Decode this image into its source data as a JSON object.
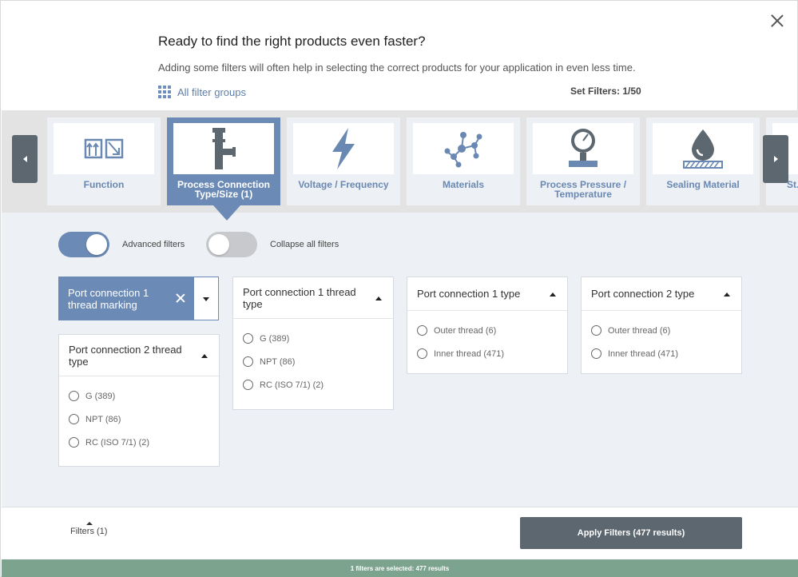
{
  "header": {
    "title": "Ready to find the right products even faster?",
    "subtitle": "Adding some filters will often help in selecting the correct products for your application in even less time.",
    "all_filter_groups": "All filter groups",
    "set_filters": "Set Filters: 1/50"
  },
  "categories": [
    {
      "label": "Function",
      "icon": "function-icon"
    },
    {
      "label": "Process Connection Type/Size (1)",
      "icon": "pipe-connection-icon",
      "active": true
    },
    {
      "label": "Voltage / Frequency",
      "icon": "lightning-icon"
    },
    {
      "label": "Materials",
      "icon": "molecule-icon"
    },
    {
      "label": "Process Pressure / Temperature",
      "icon": "pressure-gauge-icon"
    },
    {
      "label": "Sealing Material",
      "icon": "drop-icon"
    },
    {
      "label": "St... F...",
      "icon": "partial-icon"
    }
  ],
  "toggles": {
    "advanced": "Advanced filters",
    "collapse": "Collapse all filters"
  },
  "selected_chip": {
    "label": "Port connection 1 thread marking"
  },
  "filter_cards": [
    {
      "title": "Port connection 1 thread type",
      "options": [
        "G (389)",
        "NPT (86)",
        "RC (ISO 7/1) (2)"
      ]
    },
    {
      "title": "Port connection 1 type",
      "options": [
        "Outer thread (6)",
        "Inner thread (471)"
      ]
    },
    {
      "title": "Port connection 2 type",
      "options": [
        "Outer thread (6)",
        "Inner thread (471)"
      ]
    },
    {
      "title": "Port connection 2 thread type",
      "options": [
        "G (389)",
        "NPT (86)",
        "RC (ISO 7/1) (2)"
      ]
    }
  ],
  "footer": {
    "filters_toggle": "Filters (1)",
    "apply_button": "Apply Filters (477 results)",
    "status": "1 filters are selected: 477 results"
  },
  "colors": {
    "accent": "#6b8ab5",
    "dark_button": "#5d6770",
    "status_bar": "#7ba38e"
  }
}
